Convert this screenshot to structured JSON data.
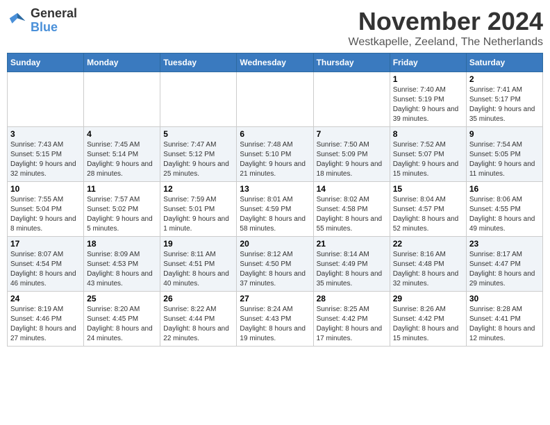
{
  "header": {
    "logo_line1": "General",
    "logo_line2": "Blue",
    "month_title": "November 2024",
    "subtitle": "Westkapelle, Zeeland, The Netherlands"
  },
  "days_of_week": [
    "Sunday",
    "Monday",
    "Tuesday",
    "Wednesday",
    "Thursday",
    "Friday",
    "Saturday"
  ],
  "weeks": [
    [
      {
        "day": "",
        "info": ""
      },
      {
        "day": "",
        "info": ""
      },
      {
        "day": "",
        "info": ""
      },
      {
        "day": "",
        "info": ""
      },
      {
        "day": "",
        "info": ""
      },
      {
        "day": "1",
        "info": "Sunrise: 7:40 AM\nSunset: 5:19 PM\nDaylight: 9 hours and 39 minutes."
      },
      {
        "day": "2",
        "info": "Sunrise: 7:41 AM\nSunset: 5:17 PM\nDaylight: 9 hours and 35 minutes."
      }
    ],
    [
      {
        "day": "3",
        "info": "Sunrise: 7:43 AM\nSunset: 5:15 PM\nDaylight: 9 hours and 32 minutes."
      },
      {
        "day": "4",
        "info": "Sunrise: 7:45 AM\nSunset: 5:14 PM\nDaylight: 9 hours and 28 minutes."
      },
      {
        "day": "5",
        "info": "Sunrise: 7:47 AM\nSunset: 5:12 PM\nDaylight: 9 hours and 25 minutes."
      },
      {
        "day": "6",
        "info": "Sunrise: 7:48 AM\nSunset: 5:10 PM\nDaylight: 9 hours and 21 minutes."
      },
      {
        "day": "7",
        "info": "Sunrise: 7:50 AM\nSunset: 5:09 PM\nDaylight: 9 hours and 18 minutes."
      },
      {
        "day": "8",
        "info": "Sunrise: 7:52 AM\nSunset: 5:07 PM\nDaylight: 9 hours and 15 minutes."
      },
      {
        "day": "9",
        "info": "Sunrise: 7:54 AM\nSunset: 5:05 PM\nDaylight: 9 hours and 11 minutes."
      }
    ],
    [
      {
        "day": "10",
        "info": "Sunrise: 7:55 AM\nSunset: 5:04 PM\nDaylight: 9 hours and 8 minutes."
      },
      {
        "day": "11",
        "info": "Sunrise: 7:57 AM\nSunset: 5:02 PM\nDaylight: 9 hours and 5 minutes."
      },
      {
        "day": "12",
        "info": "Sunrise: 7:59 AM\nSunset: 5:01 PM\nDaylight: 9 hours and 1 minute."
      },
      {
        "day": "13",
        "info": "Sunrise: 8:01 AM\nSunset: 4:59 PM\nDaylight: 8 hours and 58 minutes."
      },
      {
        "day": "14",
        "info": "Sunrise: 8:02 AM\nSunset: 4:58 PM\nDaylight: 8 hours and 55 minutes."
      },
      {
        "day": "15",
        "info": "Sunrise: 8:04 AM\nSunset: 4:57 PM\nDaylight: 8 hours and 52 minutes."
      },
      {
        "day": "16",
        "info": "Sunrise: 8:06 AM\nSunset: 4:55 PM\nDaylight: 8 hours and 49 minutes."
      }
    ],
    [
      {
        "day": "17",
        "info": "Sunrise: 8:07 AM\nSunset: 4:54 PM\nDaylight: 8 hours and 46 minutes."
      },
      {
        "day": "18",
        "info": "Sunrise: 8:09 AM\nSunset: 4:53 PM\nDaylight: 8 hours and 43 minutes."
      },
      {
        "day": "19",
        "info": "Sunrise: 8:11 AM\nSunset: 4:51 PM\nDaylight: 8 hours and 40 minutes."
      },
      {
        "day": "20",
        "info": "Sunrise: 8:12 AM\nSunset: 4:50 PM\nDaylight: 8 hours and 37 minutes."
      },
      {
        "day": "21",
        "info": "Sunrise: 8:14 AM\nSunset: 4:49 PM\nDaylight: 8 hours and 35 minutes."
      },
      {
        "day": "22",
        "info": "Sunrise: 8:16 AM\nSunset: 4:48 PM\nDaylight: 8 hours and 32 minutes."
      },
      {
        "day": "23",
        "info": "Sunrise: 8:17 AM\nSunset: 4:47 PM\nDaylight: 8 hours and 29 minutes."
      }
    ],
    [
      {
        "day": "24",
        "info": "Sunrise: 8:19 AM\nSunset: 4:46 PM\nDaylight: 8 hours and 27 minutes."
      },
      {
        "day": "25",
        "info": "Sunrise: 8:20 AM\nSunset: 4:45 PM\nDaylight: 8 hours and 24 minutes."
      },
      {
        "day": "26",
        "info": "Sunrise: 8:22 AM\nSunset: 4:44 PM\nDaylight: 8 hours and 22 minutes."
      },
      {
        "day": "27",
        "info": "Sunrise: 8:24 AM\nSunset: 4:43 PM\nDaylight: 8 hours and 19 minutes."
      },
      {
        "day": "28",
        "info": "Sunrise: 8:25 AM\nSunset: 4:42 PM\nDaylight: 8 hours and 17 minutes."
      },
      {
        "day": "29",
        "info": "Sunrise: 8:26 AM\nSunset: 4:42 PM\nDaylight: 8 hours and 15 minutes."
      },
      {
        "day": "30",
        "info": "Sunrise: 8:28 AM\nSunset: 4:41 PM\nDaylight: 8 hours and 12 minutes."
      }
    ]
  ]
}
